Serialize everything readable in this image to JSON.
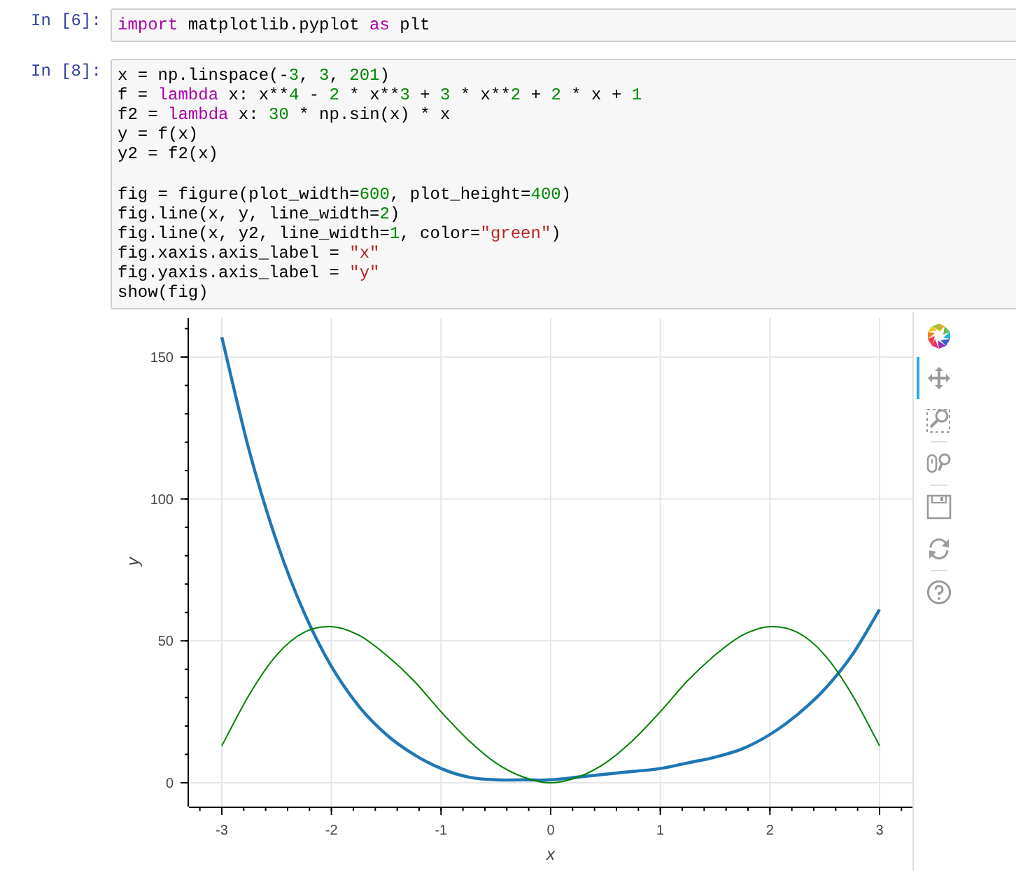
{
  "cells": [
    {
      "prompt": "In [6]:",
      "lines": [
        [
          {
            "kind": "keyword",
            "text": "import"
          },
          {
            "kind": "plain",
            "text": " matplotlib.pyplot "
          },
          {
            "kind": "keyword",
            "text": "as"
          },
          {
            "kind": "plain",
            "text": " plt"
          }
        ]
      ]
    },
    {
      "prompt": "In [8]:",
      "lines": [
        [
          {
            "kind": "plain",
            "text": "x = np.linspace(-"
          },
          {
            "kind": "number",
            "text": "3"
          },
          {
            "kind": "plain",
            "text": ", "
          },
          {
            "kind": "number",
            "text": "3"
          },
          {
            "kind": "plain",
            "text": ", "
          },
          {
            "kind": "number",
            "text": "201"
          },
          {
            "kind": "plain",
            "text": ")"
          }
        ],
        [
          {
            "kind": "plain",
            "text": "f = "
          },
          {
            "kind": "keyword",
            "text": "lambda"
          },
          {
            "kind": "plain",
            "text": " x: x**"
          },
          {
            "kind": "number",
            "text": "4"
          },
          {
            "kind": "plain",
            "text": " - "
          },
          {
            "kind": "number",
            "text": "2"
          },
          {
            "kind": "plain",
            "text": " * x**"
          },
          {
            "kind": "number",
            "text": "3"
          },
          {
            "kind": "plain",
            "text": " + "
          },
          {
            "kind": "number",
            "text": "3"
          },
          {
            "kind": "plain",
            "text": " * x**"
          },
          {
            "kind": "number",
            "text": "2"
          },
          {
            "kind": "plain",
            "text": " + "
          },
          {
            "kind": "number",
            "text": "2"
          },
          {
            "kind": "plain",
            "text": " * x + "
          },
          {
            "kind": "number",
            "text": "1"
          }
        ],
        [
          {
            "kind": "plain",
            "text": "f2 = "
          },
          {
            "kind": "keyword",
            "text": "lambda"
          },
          {
            "kind": "plain",
            "text": " x: "
          },
          {
            "kind": "number",
            "text": "30"
          },
          {
            "kind": "plain",
            "text": " * np.sin(x) * x"
          }
        ],
        [
          {
            "kind": "plain",
            "text": "y = f(x)"
          }
        ],
        {
          "blank_after": true,
          "tokens": [
            {
              "kind": "plain",
              "text": "y2 = f2(x)"
            }
          ]
        },
        [
          {
            "kind": "plain",
            "text": "fig = figure(plot_width="
          },
          {
            "kind": "number",
            "text": "600"
          },
          {
            "kind": "plain",
            "text": ", plot_height="
          },
          {
            "kind": "number",
            "text": "400"
          },
          {
            "kind": "plain",
            "text": ")"
          }
        ],
        [
          {
            "kind": "plain",
            "text": "fig.line(x, y, line_width="
          },
          {
            "kind": "number",
            "text": "2"
          },
          {
            "kind": "plain",
            "text": ")"
          }
        ],
        [
          {
            "kind": "plain",
            "text": "fig.line(x, y2, line_width="
          },
          {
            "kind": "number",
            "text": "1"
          },
          {
            "kind": "plain",
            "text": ", color="
          },
          {
            "kind": "string",
            "text": "\"green\""
          },
          {
            "kind": "plain",
            "text": ")"
          }
        ],
        [
          {
            "kind": "plain",
            "text": "fig.xaxis.axis_label = "
          },
          {
            "kind": "string",
            "text": "\"x\""
          }
        ],
        [
          {
            "kind": "plain",
            "text": "fig.yaxis.axis_label = "
          },
          {
            "kind": "string",
            "text": "\"y\""
          }
        ],
        [
          {
            "kind": "plain",
            "text": "show(fig)"
          }
        ]
      ]
    }
  ],
  "output": {
    "chart_data": {
      "type": "line",
      "grid": true,
      "xlabel": "x",
      "ylabel": "y",
      "x": [
        -3,
        -2.75,
        -2.5,
        -2.25,
        -2,
        -1.75,
        -1.5,
        -1.25,
        -1,
        -0.75,
        -0.5,
        -0.25,
        0,
        0.25,
        0.5,
        0.75,
        1,
        1.25,
        1.5,
        1.75,
        2,
        2.25,
        2.5,
        2.75,
        3
      ],
      "series": [
        {
          "color": "#1f77b4",
          "values": [
            157,
            117,
            85,
            60,
            41,
            27,
            17,
            10,
            5,
            2,
            1,
            1,
            1,
            2,
            3,
            4,
            5,
            7,
            9,
            12,
            17,
            24,
            33,
            45,
            61
          ]
        },
        {
          "color": "#008000",
          "values": [
            13,
            31,
            45,
            53,
            55,
            52,
            45,
            36,
            25,
            15,
            7,
            2,
            0,
            2,
            7,
            15,
            25,
            36,
            45,
            52,
            55,
            53,
            45,
            31,
            13
          ]
        }
      ],
      "xlim": [
        -3.3,
        3.3
      ],
      "ylim": [
        -8.4,
        163.8
      ],
      "xticks": [
        -3,
        -2,
        -1,
        0,
        1,
        2,
        3
      ],
      "yticks": [
        0,
        50,
        100,
        150
      ]
    },
    "tools": [
      {
        "kind": "logo"
      },
      {
        "kind": "pan",
        "selected": true
      },
      {
        "kind": "box_zoom",
        "selected": false
      },
      {
        "kind": "separator"
      },
      {
        "kind": "wheel_zoom",
        "selected": false
      },
      {
        "kind": "separator"
      },
      {
        "kind": "save",
        "selected": false
      },
      {
        "kind": "reset",
        "selected": false
      },
      {
        "kind": "separator"
      },
      {
        "kind": "help",
        "selected": false
      }
    ]
  }
}
